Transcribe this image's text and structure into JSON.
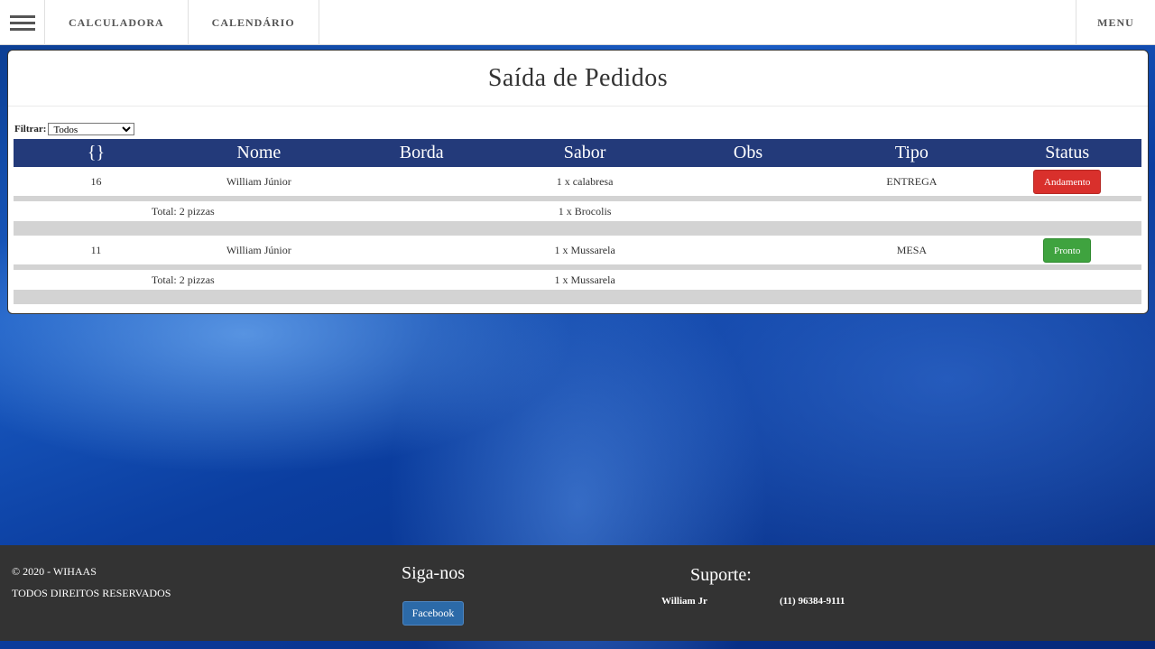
{
  "topbar": {
    "links": [
      "CALCULADORA",
      "CALENDÁRIO"
    ],
    "menu_label": "MENU"
  },
  "panel": {
    "title": "Saída de Pedidos",
    "filter_label": "Filtrar:",
    "filter_value": "Todos",
    "columns": [
      "{}",
      "Nome",
      "Borda",
      "Sabor",
      "Obs",
      "Tipo",
      "Status"
    ]
  },
  "orders": [
    {
      "id": "16",
      "name": "William Júnior",
      "borda": "",
      "sabor": "1 x calabresa",
      "obs": "",
      "tipo": "ENTREGA",
      "status": "Andamento",
      "status_color": "#d9302c",
      "total": "Total: 2 pizzas",
      "sabor2": "1 x Brocolis"
    },
    {
      "id": "11",
      "name": "William Júnior",
      "borda": "",
      "sabor": "1 x Mussarela",
      "obs": "",
      "tipo": "MESA",
      "status": "Pronto",
      "status_color": "#3fa33f",
      "total": "Total: 2 pizzas",
      "sabor2": "1 x Mussarela"
    }
  ],
  "footer": {
    "copyright": "© 2020 - WIHAAS",
    "rights": "TODOS DIREITOS RESERVADOS",
    "follow_title": "Siga-nos",
    "facebook_label": "Facebook",
    "support_title": "Suporte:",
    "support_name": "William Jr",
    "support_phone": "(11) 96384-9111"
  },
  "icons": {
    "hamburger": "hamburger-menu-icon",
    "dropdown": "chevron-down-icon"
  }
}
